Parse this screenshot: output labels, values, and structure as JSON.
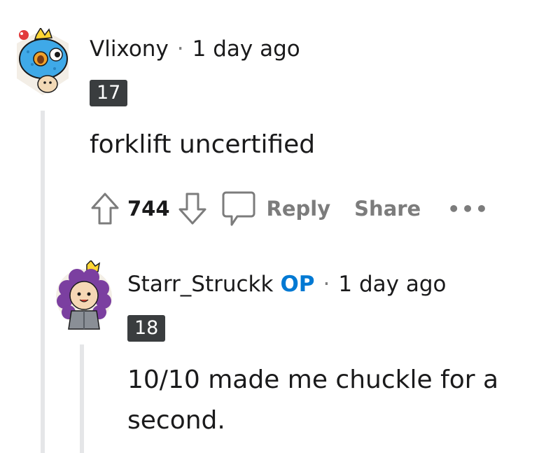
{
  "comments": [
    {
      "username": "Vlixony",
      "separator": "·",
      "time": "1 day ago",
      "flair": "17",
      "body": "forklift uncertified",
      "avatar_icon": "blue-fish-avatar",
      "votes": "744",
      "actions": {
        "reply": "Reply",
        "share": "Share",
        "more": "•••"
      }
    },
    {
      "username": "Starr_Struckk",
      "op_badge": "OP",
      "separator": "·",
      "time": "1 day ago",
      "flair": "18",
      "body": "10/10 made me chuckle for a second.",
      "avatar_icon": "curly-hair-character-avatar"
    }
  ],
  "colors": {
    "op": "#0079d3",
    "flair_bg": "#3a3d3f",
    "muted": "#7c7c7c",
    "thread_line": "#e5e6e8"
  }
}
